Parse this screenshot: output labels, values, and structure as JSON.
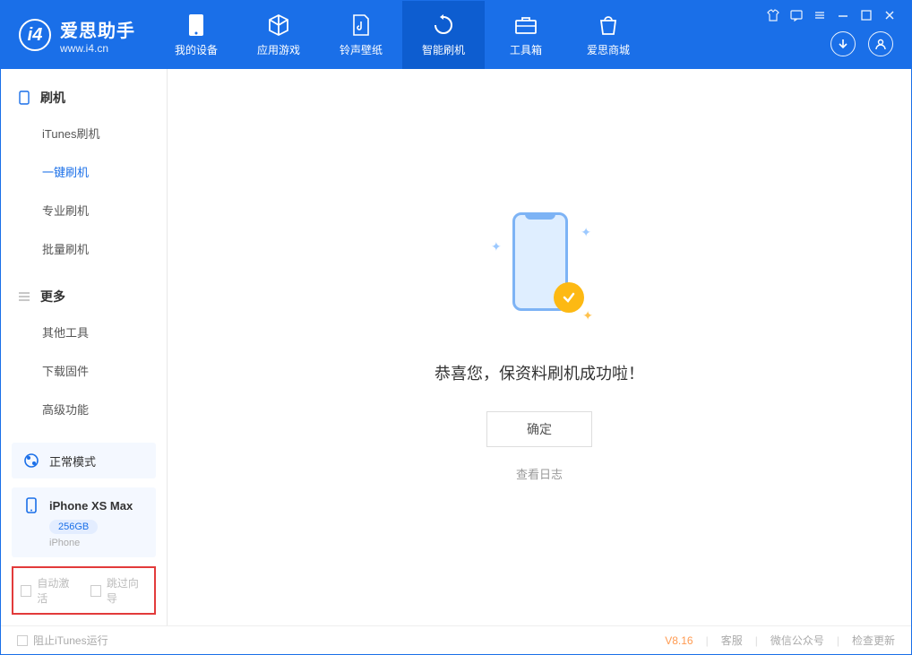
{
  "brand": {
    "name": "爱思助手",
    "url": "www.i4.cn"
  },
  "nav": {
    "items": [
      {
        "label": "我的设备"
      },
      {
        "label": "应用游戏"
      },
      {
        "label": "铃声壁纸"
      },
      {
        "label": "智能刷机"
      },
      {
        "label": "工具箱"
      },
      {
        "label": "爱思商城"
      }
    ]
  },
  "sidebar": {
    "section_flash": {
      "title": "刷机",
      "items": [
        {
          "label": "iTunes刷机"
        },
        {
          "label": "一键刷机"
        },
        {
          "label": "专业刷机"
        },
        {
          "label": "批量刷机"
        }
      ]
    },
    "section_more": {
      "title": "更多",
      "items": [
        {
          "label": "其他工具"
        },
        {
          "label": "下载固件"
        },
        {
          "label": "高级功能"
        }
      ]
    },
    "mode_label": "正常模式",
    "device": {
      "name": "iPhone XS Max",
      "storage": "256GB",
      "type": "iPhone"
    },
    "checkbox_auto_activate": "自动激活",
    "checkbox_skip_guide": "跳过向导"
  },
  "main": {
    "success_text": "恭喜您，保资料刷机成功啦！",
    "ok_button": "确定",
    "view_log": "查看日志"
  },
  "footer": {
    "block_itunes": "阻止iTunes运行",
    "version": "V8.16",
    "support": "客服",
    "wechat": "微信公众号",
    "check_update": "检查更新"
  }
}
